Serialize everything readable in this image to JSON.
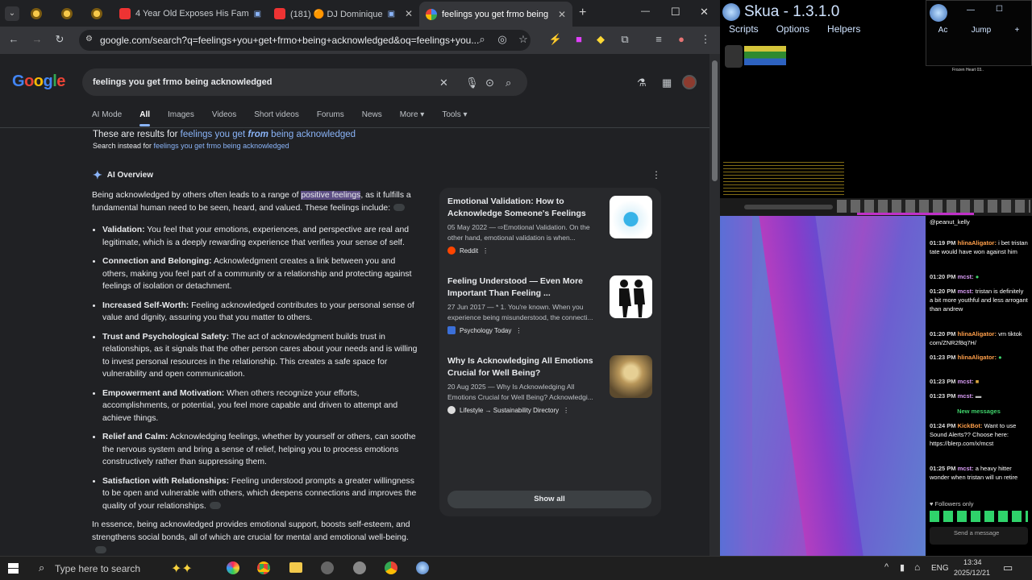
{
  "browser": {
    "tabs": [
      {
        "label": "",
        "icon": "sun-icon"
      },
      {
        "label": "",
        "icon": "sun-icon"
      },
      {
        "label": "",
        "icon": "sun-icon"
      },
      {
        "label": "4 Year Old Exposes His Fam",
        "icon": "youtube-icon"
      },
      {
        "label": "(181) 🟠 DJ Dominique",
        "icon": "youtube-icon"
      },
      {
        "label": "feelings you get frmo being ac",
        "icon": "google-icon"
      }
    ],
    "url": "google.com/search?q=feelings+you+get+frmo+being+acknowledged&oq=feelings+you...",
    "window_controls": {
      "minimize": "—",
      "maximize": "☐",
      "close": "✕"
    }
  },
  "google": {
    "logo": "Google",
    "query": "feelings you get frmo being acknowledged",
    "nav_tabs": [
      "AI Mode",
      "All",
      "Images",
      "Videos",
      "Short videos",
      "Forums",
      "News",
      "More ▾",
      "Tools ▾"
    ],
    "active_tab": "All",
    "results_prefix": "These are results for ",
    "results_link_a": "feelings you get ",
    "results_link_b": "from",
    "results_link_c": " being acknowledged",
    "search_instead_prefix": "Search instead for ",
    "search_instead_link": "feelings you get frmo being acknowledged",
    "ai_overview_label": "AI Overview",
    "intro_a": "Being acknowledged by others often leads to a range of ",
    "intro_hl": "positive feelings",
    "intro_b": ", as it fulfills a fundamental human need to be seen, heard, and valued. These feelings include:",
    "bullets": [
      {
        "title": "Validation:",
        "text": " You feel that your emotions, experiences, and perspective are real and legitimate, which is a deeply rewarding experience that verifies your sense of self."
      },
      {
        "title": "Connection and Belonging:",
        "text": " Acknowledgment creates a link between you and others, making you feel part of a community or a relationship and protecting against feelings of isolation or detachment."
      },
      {
        "title": "Increased Self-Worth:",
        "text": " Feeling acknowledged contributes to your personal sense of value and dignity, assuring you that you matter to others."
      },
      {
        "title": "Trust and Psychological Safety:",
        "text": " The act of acknowledgment builds trust in relationships, as it signals that the other person cares about your needs and is willing to invest personal resources in the relationship. This creates a safe space for vulnerability and open communication."
      },
      {
        "title": "Empowerment and Motivation:",
        "text": " When others recognize your efforts, accomplishments, or potential, you feel more capable and driven to attempt and achieve things."
      },
      {
        "title": "Relief and Calm:",
        "text": " Acknowledging feelings, whether by yourself or others, can soothe the nervous system and bring a sense of relief, helping you to process emotions constructively rather than suppressing them."
      },
      {
        "title": "Satisfaction with Relationships:",
        "text": " Feeling understood prompts a greater willingness to be open and vulnerable with others, which deepens connections and improves the quality of your relationships."
      }
    ],
    "conclusion": "In essence, being acknowledged provides emotional support, boosts self-esteem, and strengthens social bonds, all of which are crucial for mental and emotional well-being.",
    "sources": [
      {
        "title": "Emotional Validation: How to Acknowledge Someone's Feelings",
        "snippet": "05 May 2022 — ⇨Emotional Validation. On the other hand, emotional validation is when...",
        "site": "Reddit",
        "color": "#ff4500"
      },
      {
        "title": "Feeling Understood — Even More Important Than Feeling ...",
        "snippet": "27 Jun 2017 — * 1. You're known. When you experience being misunderstood, the connecti...",
        "site": "Psychology Today",
        "color": "#3b6fd8"
      },
      {
        "title": "Why Is Acknowledging All Emotions Crucial for Well Being?",
        "snippet": "20 Aug 2025 — Why Is Acknowledging All Emotions Crucial for Well Being? Acknowledgi...",
        "site": "Lifestyle → Sustainability Directory",
        "color": "#ddd"
      }
    ],
    "show_all": "Show all"
  },
  "skua": {
    "title": "Skua - 1.3.1.0",
    "menu": [
      "Scripts",
      "Options",
      "Helpers"
    ],
    "mini_menu": [
      "Ac",
      "Jump",
      "+"
    ],
    "mini_caption": "Frozen Heart 03.."
  },
  "chat": {
    "messages": [
      {
        "time": "",
        "user": "",
        "text": "@peanut_kelly"
      },
      {
        "time": "01:19 PM",
        "user": "hlinaAligator:",
        "text": "i bet tristan tate would have won against him"
      },
      {
        "time": "01:20 PM",
        "user": "mcst:",
        "text": ""
      },
      {
        "time": "01:20 PM",
        "user": "mcst:",
        "text": "tristan is definitely a bit more youthful and less arrogant than andrew"
      },
      {
        "time": "01:20 PM",
        "user": "hlinaAligator:",
        "text": "vm tiktok com/ZNR2f8q7H/"
      },
      {
        "time": "01:23 PM",
        "user": "hlinaAligator:",
        "text": ""
      },
      {
        "time": "01:23 PM",
        "user": "mcst:",
        "text": ""
      },
      {
        "time": "01:23 PM",
        "user": "mcst:",
        "text": ""
      },
      {
        "time": "01:24 PM",
        "user": "KickBot:",
        "text": "Want to use Sound Alerts?? Choose here: https://blerp.com/x/mcst"
      },
      {
        "time": "01:25 PM",
        "user": "mcst:",
        "text": "a heavy hitter wonder when tristan will un retire"
      }
    ],
    "new_messages": "New messages",
    "followers_only": "Followers only",
    "send_placeholder": "Send a message"
  },
  "taskbar": {
    "search_placeholder": "Type here to search",
    "lang": "ENG",
    "time": "13:34",
    "date": "2025/12/21"
  }
}
